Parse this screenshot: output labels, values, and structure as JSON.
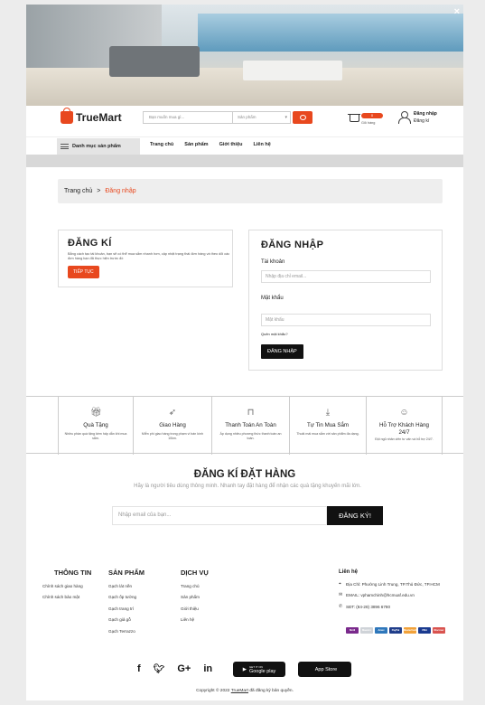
{
  "hero": {
    "close_label": "×"
  },
  "header": {
    "brand": "TrueMart",
    "search_placeholder": "Bạn muốn mua gì...",
    "category_select": "Sản phẩm",
    "cart_count": "0",
    "cart_label": "Giỏ hàng",
    "login_label": "Đăng nhập",
    "register_label": "Đăng kí"
  },
  "nav": {
    "category_label": "Danh mục sản phẩm",
    "links": [
      "Trang chủ",
      "Sản phẩm",
      "Giới thiệu",
      "Liên hệ"
    ]
  },
  "breadcrumb": {
    "home": "Trang chủ",
    "separator": ">",
    "current": "Đăng nhập"
  },
  "register": {
    "title": "ĐĂNG KÍ",
    "description": "Bằng cách tạo tài khoản, bạn sẽ có thể mua sắm nhanh hơn, cập nhật trạng thái đơn hàng và theo dõi các đơn hàng bạn đã thực hiện trước đó",
    "button": "TIẾP TỤC"
  },
  "login": {
    "title": "ĐĂNG NHẬP",
    "account_label": "Tài khoản",
    "email_placeholder": "Nhập địa chỉ email...",
    "password_label": "Mật khẩu",
    "password_placeholder": "Mật khẩu",
    "forgot": "Quên mật khẩu?",
    "button": "ĐĂNG NHẬP"
  },
  "features": [
    {
      "icon": "gift-icon",
      "title": "Quà Tặng",
      "desc": "Nhiều phần quà tặng kèm hấp dẫn khi mua sắm."
    },
    {
      "icon": "rocket-icon",
      "title": "Giao Hàng",
      "desc": "Miễn phí giao hàng trong phạm vi bán kính 10km."
    },
    {
      "icon": "lock-icon",
      "title": "Thanh Toán An Toàn",
      "desc": "Áp dụng nhiều phương thức thanh toán an toàn."
    },
    {
      "icon": "download-icon",
      "title": "Tự Tin Mua Sắm",
      "desc": "Thoải mái mua sắm với sản phẩm đa dạng."
    },
    {
      "icon": "support-icon",
      "title": "Hỗ Trợ Khách Hàng 24/7",
      "desc": "Đội ngũ nhân viên tư vấn và hỗ trợ 24/7."
    }
  ],
  "newsletter": {
    "title": "ĐĂNG KÍ ĐẶT HÀNG",
    "subtitle": "Hãy là người tiêu dùng thông minh. Nhanh tay đặt hàng để nhận các quà tặng khuyến mãi lớn.",
    "placeholder": "Nhập email của bạn...",
    "button": "ĐĂNG KÝ!"
  },
  "footer": {
    "info": {
      "title": "THÔNG TIN",
      "items": [
        "Chính sách giao hàng",
        "Chính sách bảo mật"
      ]
    },
    "products": {
      "title": "SẢN PHẨM",
      "items": [
        "Gạch lát nền",
        "Gạch ốp tường",
        "Gạch trang trí",
        "Gạch giả gỗ",
        "Gạch Terrazzo"
      ]
    },
    "services": {
      "title": "DỊCH VỤ",
      "items": [
        "Trang chủ",
        "Sản phẩm",
        "Giới thiệu",
        "Liên hệ"
      ]
    },
    "contact": {
      "title": "Liên hệ",
      "address": "Địa Chỉ: Phường Linh Trung, TP.Thủ Đức, TP.HCM",
      "email": "EMAIL: vphamchinh@hcmuaf.edu.vn",
      "phone": "SĐT: (84-28) 3896 6780"
    },
    "payments": [
      {
        "name": "Skrill",
        "color": "#7a2a8c"
      },
      {
        "name": "Maestro",
        "color": "#cfd3d8"
      },
      {
        "name": "Amex",
        "color": "#2e77bb"
      },
      {
        "name": "PayPal",
        "color": "#1f3d8a"
      },
      {
        "name": "MasterCard",
        "color": "#f2a23a"
      },
      {
        "name": "VISA",
        "color": "#1a3a8f"
      },
      {
        "name": "Discover",
        "color": "#d9534f"
      }
    ],
    "social": [
      "f",
      "🐦",
      "G+",
      "in"
    ],
    "google_play": {
      "small": "GET IT ON",
      "label": "Google play"
    },
    "app_store": {
      "small": "",
      "label": "App Store"
    },
    "copyright_pre": "Copyright © 2022",
    "copyright_brand": "TrueMart",
    "copyright_post": "đã đăng ký bản quyền."
  }
}
